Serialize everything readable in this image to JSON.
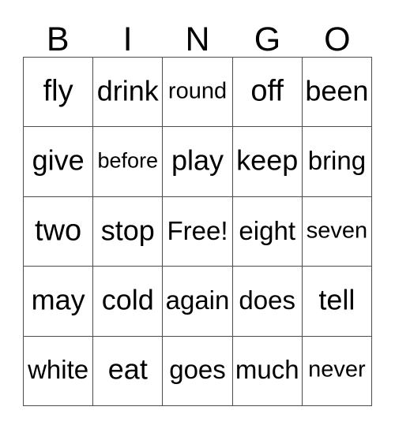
{
  "card": {
    "title_letters": [
      "B",
      "I",
      "N",
      "G",
      "O"
    ],
    "grid_colors": {
      "border": "#4d4d4d",
      "text": "#000000",
      "background": "#ffffff"
    },
    "rows": [
      [
        {
          "label": "fly",
          "size": "xl"
        },
        {
          "label": "drink",
          "size": "lg"
        },
        {
          "label": "round",
          "size": "sm"
        },
        {
          "label": "off",
          "size": "xl"
        },
        {
          "label": "been",
          "size": "lg"
        }
      ],
      [
        {
          "label": "give",
          "size": "lg"
        },
        {
          "label": "before",
          "size": "xs"
        },
        {
          "label": "play",
          "size": "lg"
        },
        {
          "label": "keep",
          "size": "lg"
        },
        {
          "label": "bring",
          "size": "md"
        }
      ],
      [
        {
          "label": "two",
          "size": "xl"
        },
        {
          "label": "stop",
          "size": "lg"
        },
        {
          "label": "Free!",
          "size": "md"
        },
        {
          "label": "eight",
          "size": "md"
        },
        {
          "label": "seven",
          "size": "sm"
        }
      ],
      [
        {
          "label": "may",
          "size": "lg"
        },
        {
          "label": "cold",
          "size": "lg"
        },
        {
          "label": "again",
          "size": "md"
        },
        {
          "label": "does",
          "size": "md"
        },
        {
          "label": "tell",
          "size": "lg"
        }
      ],
      [
        {
          "label": "white",
          "size": "md"
        },
        {
          "label": "eat",
          "size": "lg"
        },
        {
          "label": "goes",
          "size": "md"
        },
        {
          "label": "much",
          "size": "md"
        },
        {
          "label": "never",
          "size": "sm"
        }
      ]
    ]
  }
}
